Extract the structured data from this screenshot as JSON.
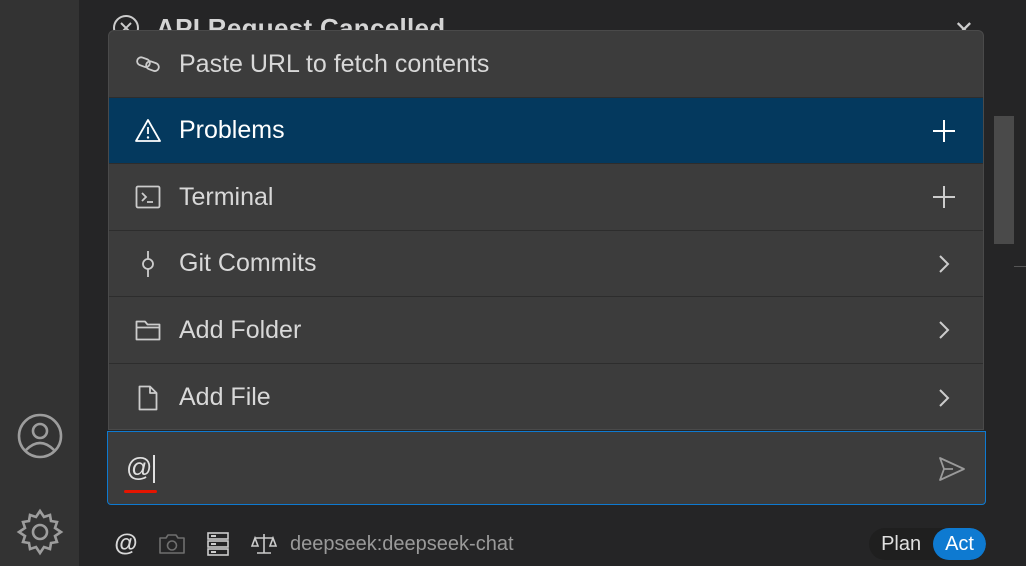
{
  "background_banner": {
    "title": "API Request Cancelled"
  },
  "menu": {
    "items": [
      {
        "label": "Paste URL to fetch contents",
        "icon": "link-icon",
        "action": ""
      },
      {
        "label": "Problems",
        "icon": "warning-icon",
        "action": "plus",
        "selected": true
      },
      {
        "label": "Terminal",
        "icon": "terminal-icon",
        "action": "plus"
      },
      {
        "label": "Git Commits",
        "icon": "git-commit-icon",
        "action": "chevron-right"
      },
      {
        "label": "Add Folder",
        "icon": "folder-icon",
        "action": "chevron-right"
      },
      {
        "label": "Add File",
        "icon": "file-icon",
        "action": "chevron-right"
      }
    ]
  },
  "input": {
    "value": "@"
  },
  "toolbar": {
    "mention_label": "@",
    "model": "deepseek:deepseek-chat",
    "modes": [
      "Plan",
      "Act"
    ],
    "active_mode": "Act"
  },
  "colors": {
    "selected_row": "#04395e",
    "accent": "#0e7ad1",
    "error_squiggle": "#e51400"
  }
}
